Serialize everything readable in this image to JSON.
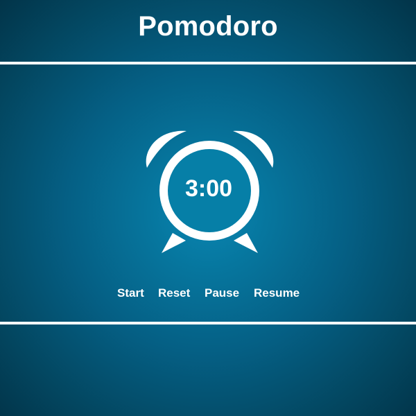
{
  "header": {
    "title": "Pomodoro"
  },
  "timer": {
    "display": "3:00",
    "icon": "alarm-clock-icon"
  },
  "controls": [
    {
      "label": "Start"
    },
    {
      "label": "Reset"
    },
    {
      "label": "Pause"
    },
    {
      "label": "Resume"
    }
  ],
  "colors": {
    "background_center": "#0a86b2",
    "background_edge": "#023449",
    "foreground": "#ffffff"
  }
}
